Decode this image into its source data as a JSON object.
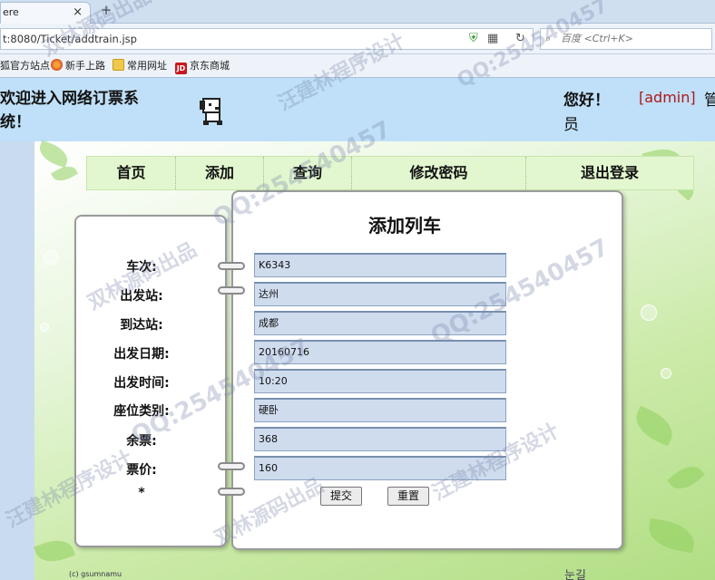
{
  "browser": {
    "tab_title": "ere",
    "tab_close": "×",
    "new_tab": "+",
    "url": "t:8080/Ticket/addtrain.jsp",
    "search_placeholder": "百度 <Ctrl+K>",
    "bookmarks": [
      "狐官方站点",
      "新手上路",
      "常用网址",
      "京东商城"
    ]
  },
  "header": {
    "welcome": "欢迎进入网络订票系统！",
    "greeting": "您好！",
    "username": "[admin]",
    "role_part1": "管",
    "role_part2": "员"
  },
  "nav": {
    "items": [
      "首页",
      "添加",
      "查询",
      "修改密码",
      "退出登录"
    ]
  },
  "form": {
    "title": "添加列车",
    "fields": [
      {
        "label": "车次:",
        "value": "K6343"
      },
      {
        "label": "出发站:",
        "value": "达州"
      },
      {
        "label": "到达站:",
        "value": "成都"
      },
      {
        "label": "出发日期:",
        "value": "20160716"
      },
      {
        "label": "出发时间:",
        "value": "10:20"
      },
      {
        "label": "座位类别:",
        "value": "硬卧"
      },
      {
        "label": "余票:",
        "value": "368"
      },
      {
        "label": "票价:",
        "value": "160"
      }
    ],
    "required_mark": "*",
    "submit_label": "提交",
    "reset_label": "重置"
  },
  "footer": {
    "copyright": "(c) gsumnamu",
    "signature": "눈길"
  },
  "watermarks": [
    "QQ:254540457",
    "汪建林程序设计",
    "双林源码出品"
  ],
  "colors": {
    "header_bg": "#bfe0f8",
    "admin": "#b01818",
    "input_bg": "#cfdcee",
    "nav_bg": "#e2f7cf"
  }
}
